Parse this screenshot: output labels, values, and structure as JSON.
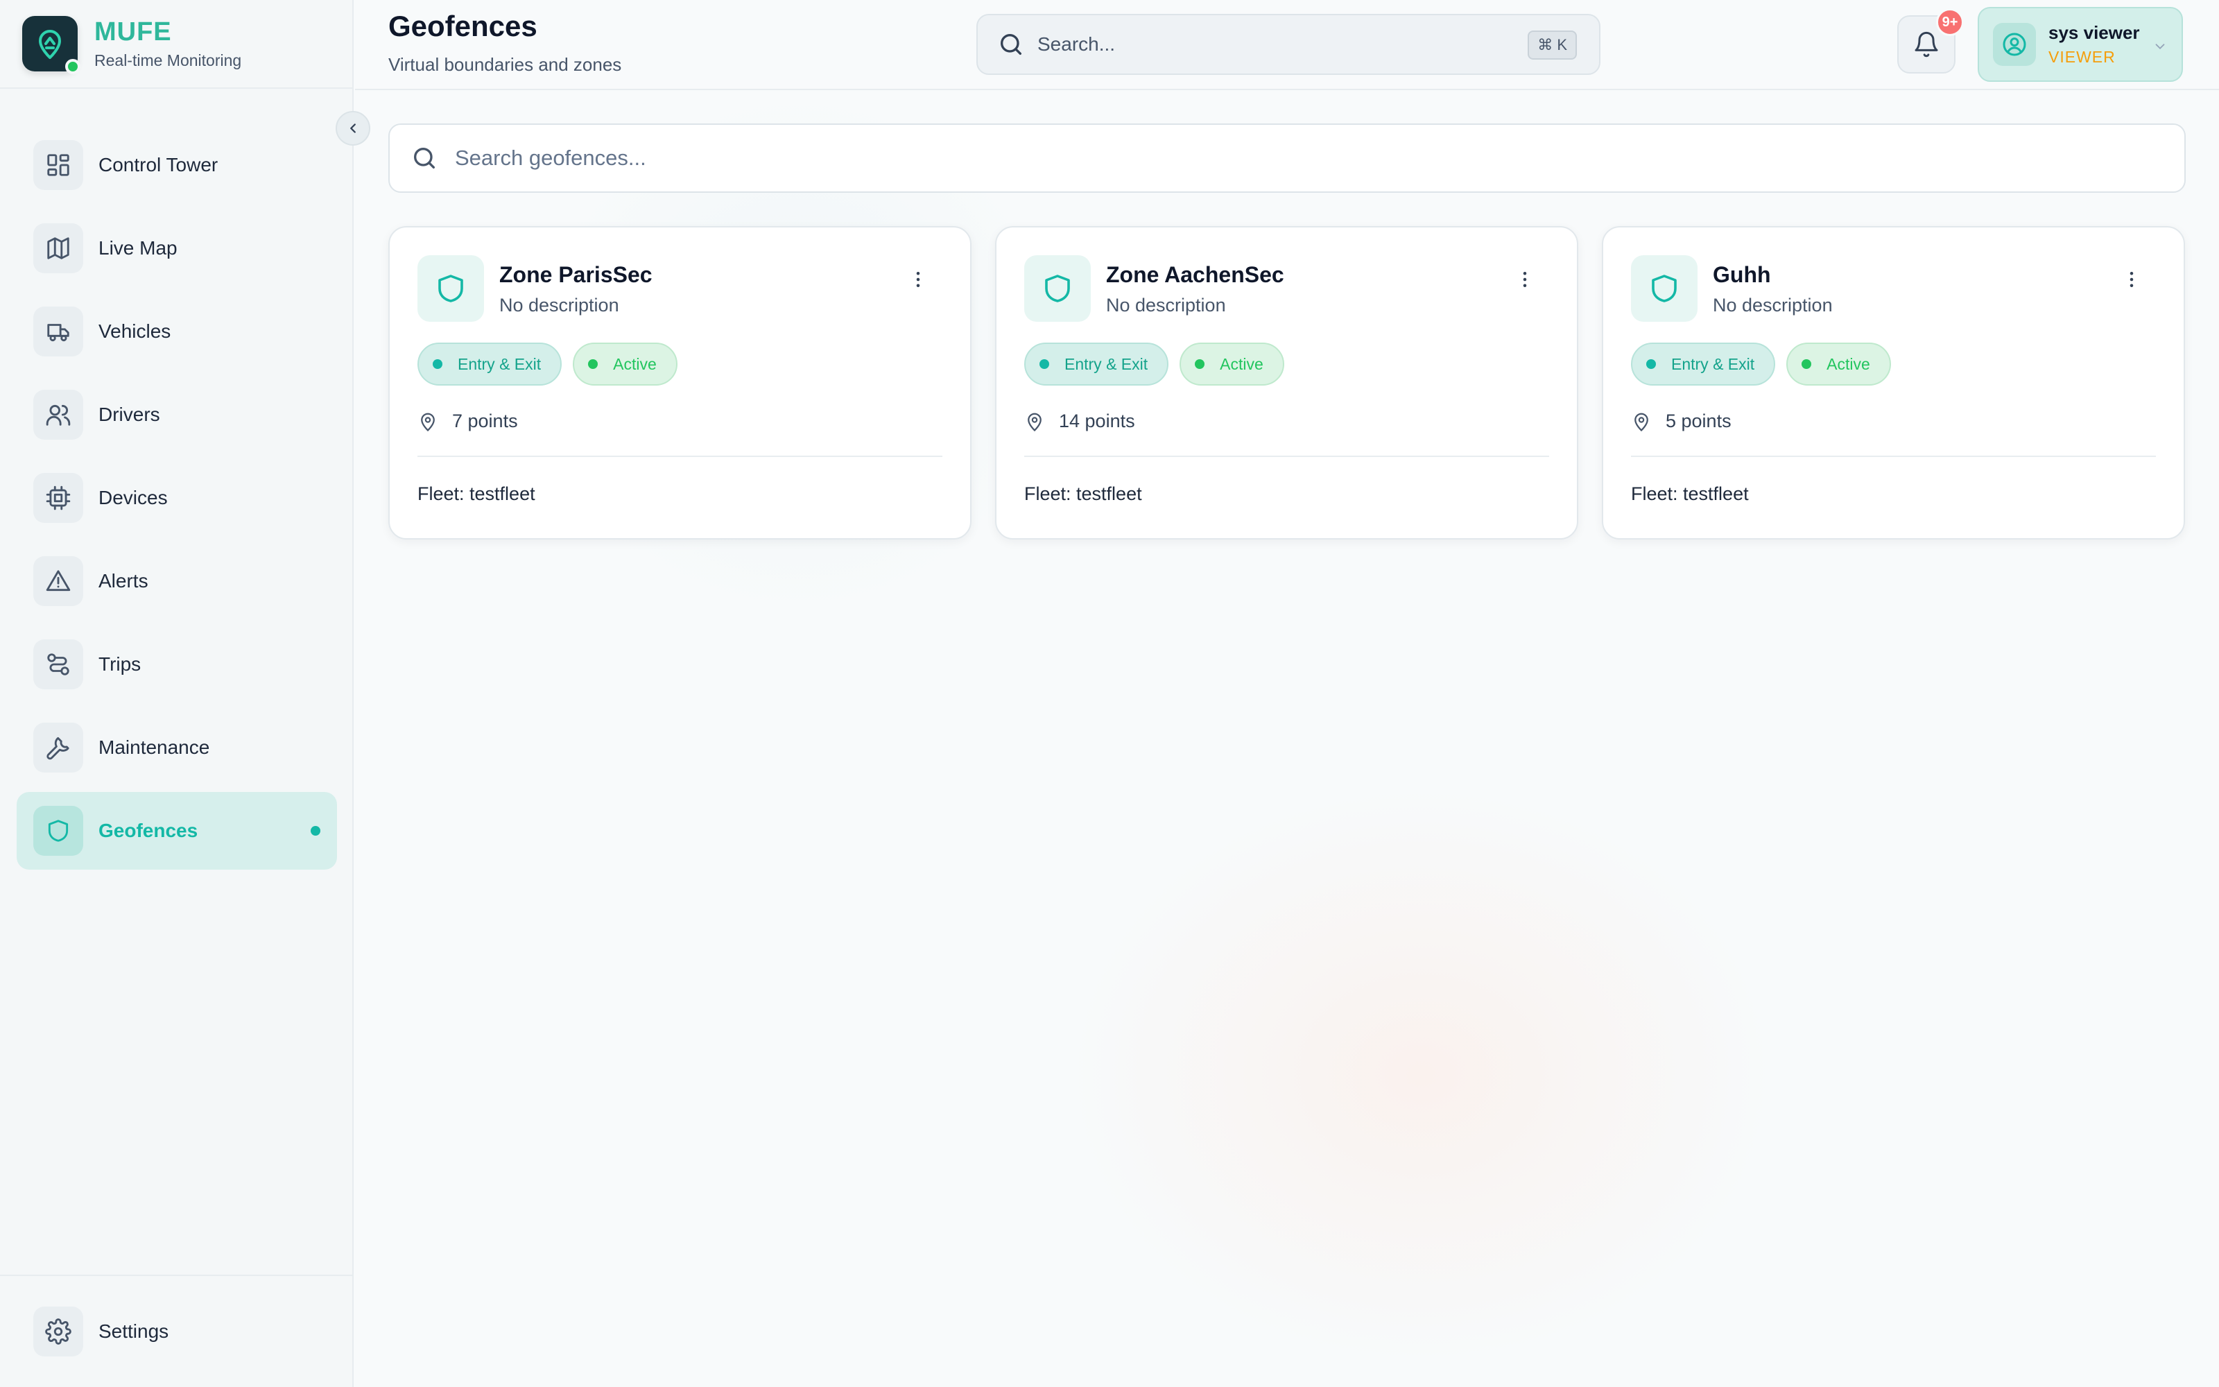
{
  "brand": {
    "name": "MUFE",
    "subtitle": "Real-time Monitoring"
  },
  "header": {
    "title": "Geofences",
    "subtitle": "Virtual boundaries and zones",
    "search_placeholder": "Search...",
    "search_shortcut": "⌘ K",
    "notification_badge": "9+",
    "user": {
      "name": "sys viewer",
      "role": "VIEWER"
    }
  },
  "sidebar": {
    "items": [
      {
        "label": "Control Tower",
        "icon": "grid-icon"
      },
      {
        "label": "Live Map",
        "icon": "map-icon"
      },
      {
        "label": "Vehicles",
        "icon": "truck-icon"
      },
      {
        "label": "Drivers",
        "icon": "users-icon"
      },
      {
        "label": "Devices",
        "icon": "cpu-icon"
      },
      {
        "label": "Alerts",
        "icon": "warning-icon"
      },
      {
        "label": "Trips",
        "icon": "route-icon"
      },
      {
        "label": "Maintenance",
        "icon": "wrench-icon"
      },
      {
        "label": "Geofences",
        "icon": "shield-icon",
        "active": true
      }
    ],
    "settings_label": "Settings"
  },
  "main": {
    "search_placeholder": "Search geofences...",
    "cards": [
      {
        "title": "Zone ParisSec",
        "description": "No description",
        "type_badge": "Entry & Exit",
        "status_badge": "Active",
        "points": "7 points",
        "fleet": "Fleet: testfleet"
      },
      {
        "title": "Zone AachenSec",
        "description": "No description",
        "type_badge": "Entry & Exit",
        "status_badge": "Active",
        "points": "14 points",
        "fleet": "Fleet: testfleet"
      },
      {
        "title": "Guhh",
        "description": "No description",
        "type_badge": "Entry & Exit",
        "status_badge": "Active",
        "points": "5 points",
        "fleet": "Fleet: testfleet"
      }
    ]
  },
  "colors": {
    "accent": "#14b8a6",
    "active_green": "#22c55e",
    "role": "#f59e0b",
    "badge_red": "#f87171"
  }
}
